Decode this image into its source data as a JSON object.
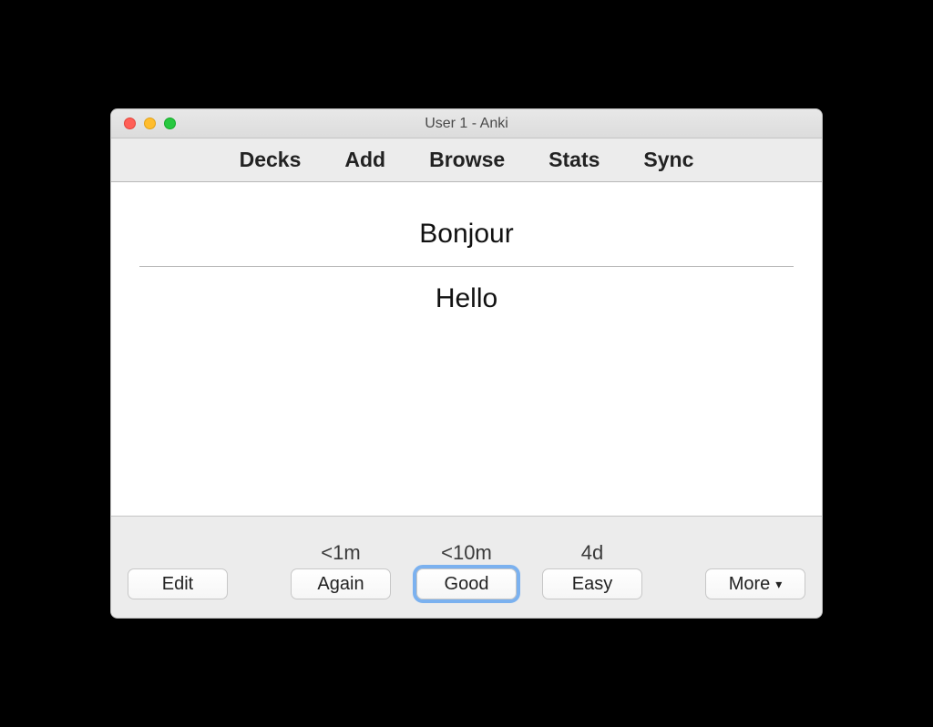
{
  "window": {
    "title": "User 1 - Anki"
  },
  "topnav": {
    "decks": "Decks",
    "add": "Add",
    "browse": "Browse",
    "stats": "Stats",
    "sync": "Sync"
  },
  "card": {
    "front": "Bonjour",
    "back": "Hello"
  },
  "bottom": {
    "edit": "Edit",
    "more": "More",
    "answers": {
      "again": {
        "interval": "<1m",
        "label": "Again"
      },
      "good": {
        "interval": "<10m",
        "label": "Good"
      },
      "easy": {
        "interval": "4d",
        "label": "Easy"
      }
    }
  }
}
